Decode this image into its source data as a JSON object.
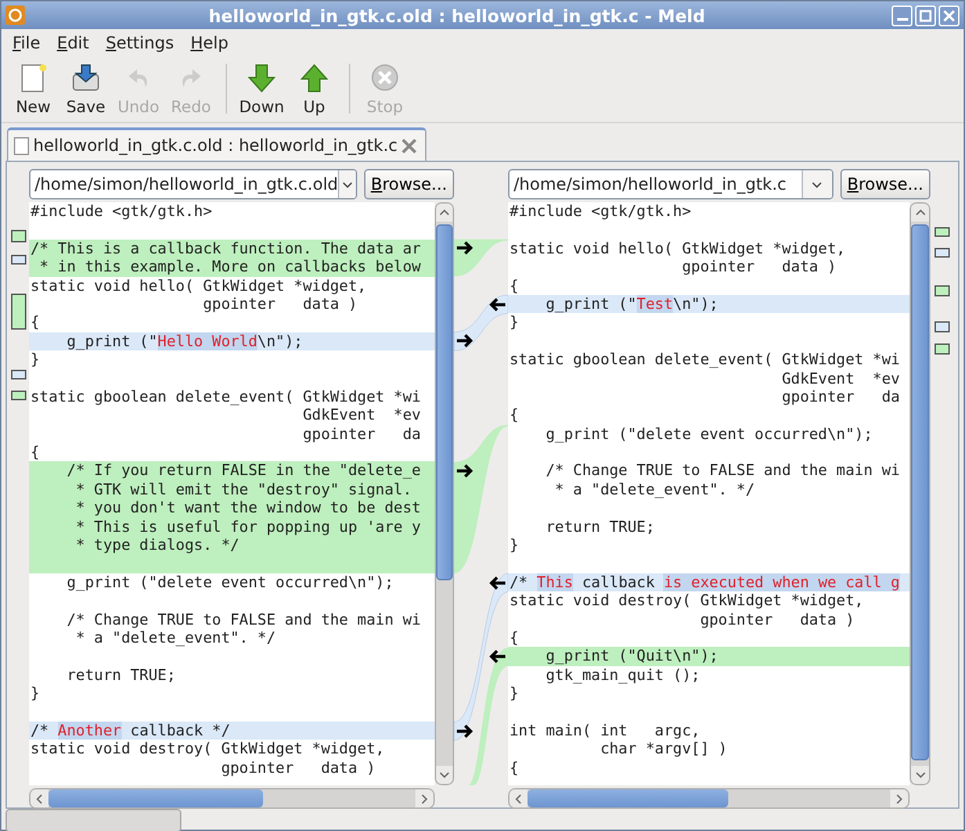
{
  "window": {
    "title": "helloworld_in_gtk.c.old : helloworld_in_gtk.c - Meld"
  },
  "menu": [
    "File",
    "Edit",
    "Settings",
    "Help"
  ],
  "toolbar": [
    {
      "items": [
        {
          "label": "New",
          "kind": "new",
          "disabled": false
        },
        {
          "label": "Save",
          "kind": "save",
          "disabled": false
        },
        {
          "label": "Undo",
          "kind": "undo",
          "disabled": true
        },
        {
          "label": "Redo",
          "kind": "redo",
          "disabled": true
        }
      ]
    },
    {
      "items": [
        {
          "label": "Down",
          "kind": "down",
          "disabled": false
        },
        {
          "label": "Up",
          "kind": "up",
          "disabled": false
        }
      ]
    },
    {
      "items": [
        {
          "label": "Stop",
          "kind": "stop",
          "disabled": true
        }
      ]
    }
  ],
  "tabs": [
    {
      "label": "helloworld_in_gtk.c.old : helloworld_in_gtk.c",
      "selected": true
    }
  ],
  "panes": [
    {
      "path": "/home/simon/helloworld_in_gtk.c.old",
      "browse": "Browse...",
      "lines": [
        {
          "kind": "plain",
          "text": "#include <gtk/gtk.h>"
        },
        {
          "kind": "plain"
        },
        {
          "kind": "insert",
          "text": "/* This is a callback function. The data ar"
        },
        {
          "kind": "insert",
          "text": " * in this example. More on callbacks below"
        },
        {
          "kind": "plain",
          "text": "static void hello( GtkWidget *widget,"
        },
        {
          "kind": "plain",
          "text": "                   gpointer   data )"
        },
        {
          "kind": "plain",
          "text": "{"
        },
        {
          "kind": "change",
          "segments": [
            {
              "text": "    g_print (\"",
              "changed": false
            },
            {
              "text": "Hello World",
              "changed": true
            },
            {
              "text": "\\n\");",
              "changed": false
            }
          ]
        },
        {
          "kind": "plain",
          "text": "}"
        },
        {
          "kind": "plain"
        },
        {
          "kind": "plain",
          "text": "static gboolean delete_event( GtkWidget *wi"
        },
        {
          "kind": "plain",
          "text": "                              GdkEvent  *ev"
        },
        {
          "kind": "plain",
          "text": "                              gpointer   da"
        },
        {
          "kind": "plain",
          "text": "{"
        },
        {
          "kind": "insert",
          "text": "    /* If you return FALSE in the \"delete_e"
        },
        {
          "kind": "insert",
          "text": "     * GTK will emit the \"destroy\" signal."
        },
        {
          "kind": "insert",
          "text": "     * you don't want the window to be dest"
        },
        {
          "kind": "insert",
          "text": "     * This is useful for popping up 'are y"
        },
        {
          "kind": "insert",
          "text": "     * type dialogs. */"
        },
        {
          "kind": "insert"
        },
        {
          "kind": "plain",
          "text": "    g_print (\"delete event occurred\\n\");"
        },
        {
          "kind": "plain"
        },
        {
          "kind": "plain",
          "text": "    /* Change TRUE to FALSE and the main wi"
        },
        {
          "kind": "plain",
          "text": "     * a \"delete_event\". */"
        },
        {
          "kind": "plain"
        },
        {
          "kind": "plain",
          "text": "    return TRUE;"
        },
        {
          "kind": "plain",
          "text": "}"
        },
        {
          "kind": "plain"
        },
        {
          "kind": "change",
          "segments": [
            {
              "text": "/* ",
              "changed": false
            },
            {
              "text": "Another",
              "changed": true
            },
            {
              "text": " callback */",
              "changed": false
            }
          ]
        },
        {
          "kind": "plain",
          "text": "static void destroy( GtkWidget *widget,"
        },
        {
          "kind": "plain",
          "text": "                     gpointer   data )"
        }
      ]
    },
    {
      "path": "/home/simon/helloworld_in_gtk.c",
      "browse": "Browse...",
      "lines": [
        {
          "kind": "plain",
          "text": "#include <gtk/gtk.h>"
        },
        {
          "kind": "plain"
        },
        {
          "kind": "plain",
          "text": "static void hello( GtkWidget *widget,"
        },
        {
          "kind": "plain",
          "text": "                   gpointer   data )"
        },
        {
          "kind": "plain",
          "text": "{"
        },
        {
          "kind": "change",
          "segments": [
            {
              "text": "    g_print (\"",
              "changed": false
            },
            {
              "text": "Test",
              "changed": true
            },
            {
              "text": "\\n\");",
              "changed": false
            }
          ]
        },
        {
          "kind": "plain",
          "text": "}"
        },
        {
          "kind": "plain"
        },
        {
          "kind": "plain",
          "text": "static gboolean delete_event( GtkWidget *wi"
        },
        {
          "kind": "plain",
          "text": "                              GdkEvent  *ev"
        },
        {
          "kind": "plain",
          "text": "                              gpointer   da"
        },
        {
          "kind": "plain",
          "text": "{"
        },
        {
          "kind": "plain",
          "text": "    g_print (\"delete event occurred\\n\");"
        },
        {
          "kind": "plain"
        },
        {
          "kind": "plain",
          "text": "    /* Change TRUE to FALSE and the main wi"
        },
        {
          "kind": "plain",
          "text": "     * a \"delete_event\". */"
        },
        {
          "kind": "plain"
        },
        {
          "kind": "plain",
          "text": "    return TRUE;"
        },
        {
          "kind": "plain",
          "text": "}"
        },
        {
          "kind": "plain"
        },
        {
          "kind": "change",
          "segments": [
            {
              "text": "/* ",
              "changed": false
            },
            {
              "text": "This",
              "changed": true
            },
            {
              "text": " callback ",
              "changed": false
            },
            {
              "text": "is executed when we call g",
              "changed": true
            }
          ]
        },
        {
          "kind": "plain",
          "text": "static void destroy( GtkWidget *widget,"
        },
        {
          "kind": "plain",
          "text": "                     gpointer   data )"
        },
        {
          "kind": "plain",
          "text": "{"
        },
        {
          "kind": "insert",
          "text": "    g_print (\"Quit\\n\");"
        },
        {
          "kind": "plain",
          "text": "    gtk_main_quit ();"
        },
        {
          "kind": "plain",
          "text": "}"
        },
        {
          "kind": "plain"
        },
        {
          "kind": "plain",
          "text": "int main( int   argc,"
        },
        {
          "kind": "plain",
          "text": "          char *argv[] )"
        },
        {
          "kind": "plain",
          "text": "{"
        }
      ]
    }
  ]
}
